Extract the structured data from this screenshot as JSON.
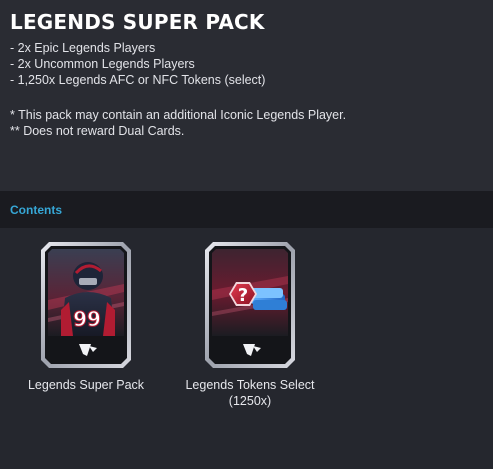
{
  "pack": {
    "title": "LEGENDS SUPER PACK",
    "bullets": [
      "- 2x Epic Legends Players",
      "- 2x Uncommon Legends Players",
      "- 1,250x Legends AFC or NFC Tokens (select)"
    ],
    "notes": [
      "* This pack may contain an additional Iconic Legends Player.",
      "** Does not reward Dual Cards."
    ]
  },
  "contents": {
    "label": "Contents",
    "items": [
      {
        "label": "Legends Super Pack",
        "jersey_number": "99",
        "icon": "player-card-icon"
      },
      {
        "label_line1": "Legends Tokens Select",
        "label_line2": "(1250x)",
        "token_symbol": "?",
        "icon": "token-card-icon"
      }
    ]
  },
  "colors": {
    "accent": "#36a7d6",
    "header_bg": "#2a2c33",
    "bar_bg": "#1a1b20",
    "body_bg": "#25272e",
    "card_red": "#a8192e",
    "token_blue": "#2f7fd6"
  }
}
